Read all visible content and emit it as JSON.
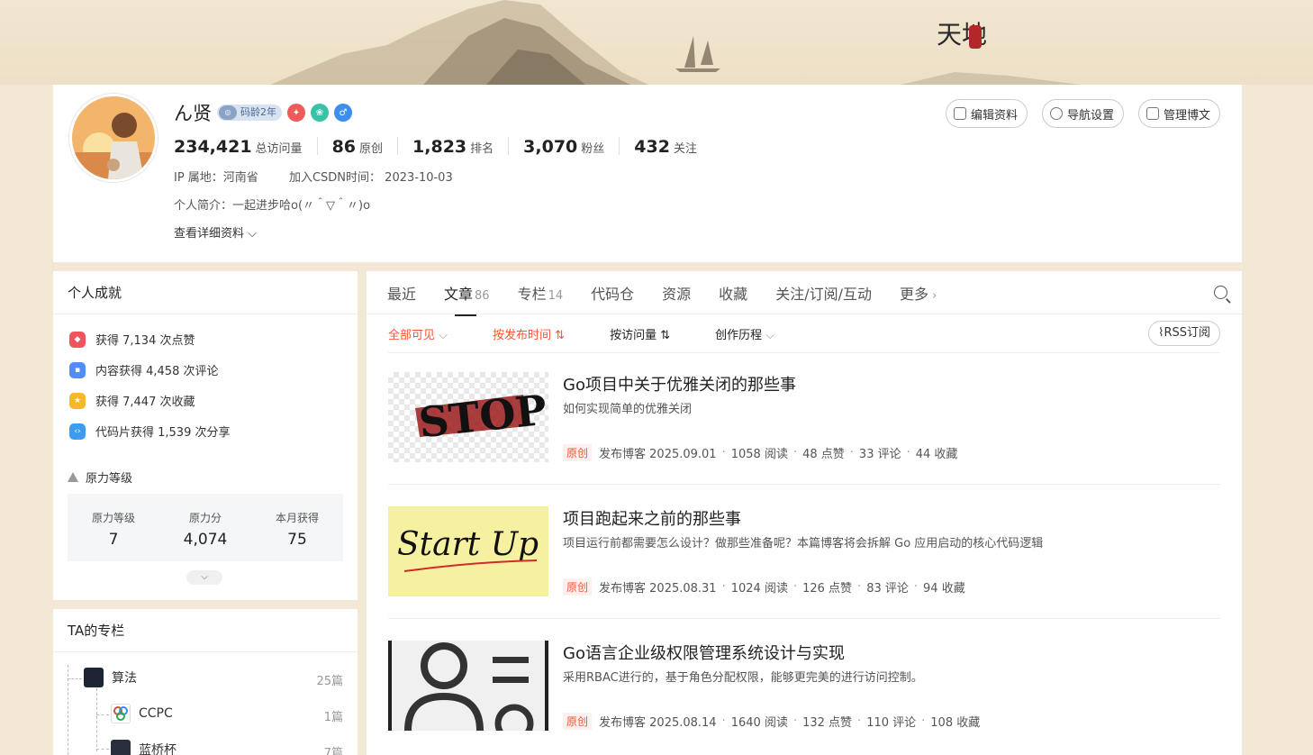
{
  "user": {
    "name": "ん贤",
    "code_age": "码龄2年",
    "stats": [
      {
        "value": "234,421",
        "label": "总访问量"
      },
      {
        "value": "86",
        "label": "原创"
      },
      {
        "value": "1,823",
        "label": "排名"
      },
      {
        "value": "3,070",
        "label": "粉丝"
      },
      {
        "value": "432",
        "label": "关注"
      }
    ],
    "ip_label": "IP 属地：河南省",
    "join_label": "加入CSDN时间：",
    "join_date": "2023-10-03",
    "bio": "个人简介：一起进步哈o(〃＾▽＾〃)o",
    "details_link": "查看详细资料"
  },
  "top_buttons": {
    "edit": "编辑资料",
    "nav": "导航设置",
    "manage": "管理博文"
  },
  "achievements": {
    "title": "个人成就",
    "items": [
      {
        "text": "获得 7,134 次点赞",
        "color": "#f0555f"
      },
      {
        "text": "内容获得 4,458 次评论",
        "color": "#4d8ef8"
      },
      {
        "text": "获得 7,447 次收藏",
        "color": "#f5b829"
      },
      {
        "text": "代码片获得 1,539 次分享",
        "color": "#3d9cf0"
      }
    ],
    "power_title": "原力等级",
    "power": [
      {
        "label": "原力等级",
        "value": "7"
      },
      {
        "label": "原力分",
        "value": "4,074"
      },
      {
        "label": "本月获得",
        "value": "75"
      }
    ]
  },
  "columns": {
    "title": "TA的专栏",
    "items": [
      {
        "name": "算法",
        "count": "25篇"
      },
      {
        "name": "CCPC",
        "count": "1篇"
      },
      {
        "name": "蓝桥杯",
        "count": "7篇"
      }
    ]
  },
  "tabs": [
    {
      "label": "最近",
      "count": ""
    },
    {
      "label": "文章",
      "count": "86"
    },
    {
      "label": "专栏",
      "count": "14"
    },
    {
      "label": "代码仓",
      "count": ""
    },
    {
      "label": "资源",
      "count": ""
    },
    {
      "label": "收藏",
      "count": ""
    },
    {
      "label": "关注/订阅/互动",
      "count": ""
    },
    {
      "label": "更多",
      "count": ""
    }
  ],
  "filters": {
    "visibility": "全部可见",
    "by_time": "按发布时间",
    "by_views": "按访问量",
    "history": "创作历程",
    "rss": "RSS订阅"
  },
  "articles": [
    {
      "title": "Go项目中关于优雅关闭的那些事",
      "desc": "如何实现简单的优雅关闭",
      "tag": "原创",
      "date": "发布博客 2025.09.01",
      "reads": "1058 阅读",
      "likes": "48 点赞",
      "comments": "33 评论",
      "favs": "44 收藏",
      "thumb_text": "STOP"
    },
    {
      "title": "项目跑起来之前的那些事",
      "desc": "项目运行前都需要怎么设计？做那些准备呢？本篇博客将会拆解 Go 应用启动的核心代码逻辑",
      "tag": "原创",
      "date": "发布博客 2025.08.31",
      "reads": "1024 阅读",
      "likes": "126 点赞",
      "comments": "83 评论",
      "favs": "94 收藏",
      "thumb_text": "Start Up"
    },
    {
      "title": "Go语言企业级权限管理系统设计与实现",
      "desc": "采用RBAC进行的，基于角色分配权限，能够更完美的进行访问控制。",
      "tag": "原创",
      "date": "发布博客 2025.08.14",
      "reads": "1640 阅读",
      "likes": "132 点赞",
      "comments": "110 评论",
      "favs": "108 收藏",
      "thumb_text": ""
    }
  ]
}
